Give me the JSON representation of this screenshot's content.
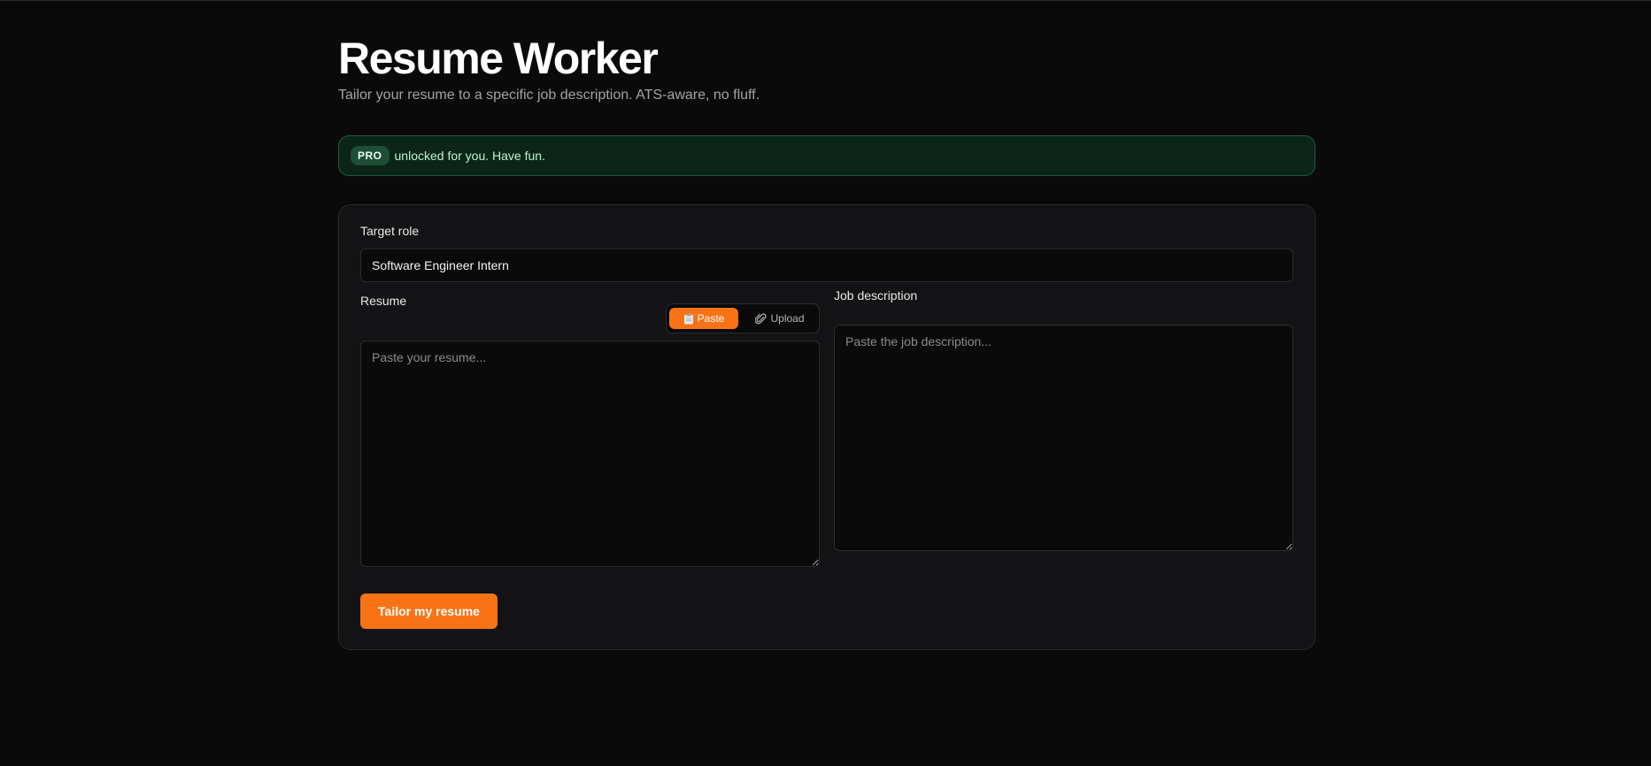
{
  "header": {
    "title": "Resume Worker",
    "subtitle": "Tailor your resume to a specific job description. ATS-aware, no fluff."
  },
  "banner": {
    "badge": "PRO",
    "text": "unlocked for you. Have fun."
  },
  "form": {
    "target_role_label": "Target role",
    "target_role_value": "Software Engineer Intern",
    "resume_label": "Resume",
    "resume_placeholder": "Paste your resume...",
    "resume_mode": {
      "paste_label": "Paste",
      "paste_icon": "clipboard-icon",
      "upload_label": "Upload",
      "upload_icon": "paperclip-icon",
      "selected": "Paste"
    },
    "job_description_label": "Job description",
    "job_description_placeholder": "Paste the job description...",
    "submit_label": "Tailor my resume"
  },
  "colors": {
    "accent": "#f97316",
    "background": "#0a0a0a",
    "card": "#131316",
    "success_border": "#1d5c3d"
  }
}
